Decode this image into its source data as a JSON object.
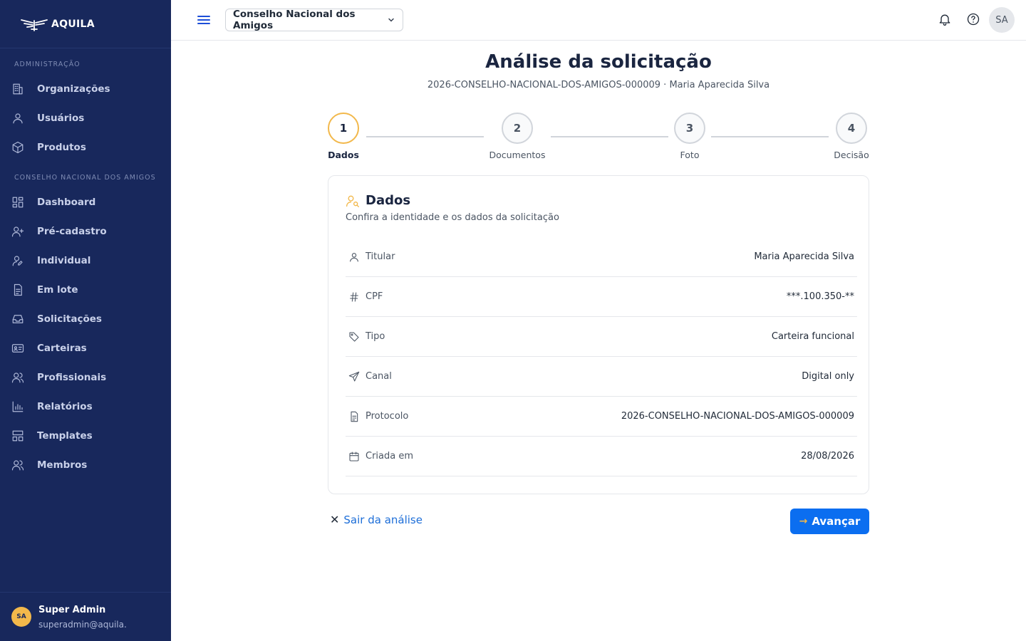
{
  "brand": {
    "name": "AQUILA"
  },
  "sidebar": {
    "section_admin": "ADMINISTRAÇÃO",
    "admin_items": [
      {
        "label": "Organizações",
        "icon": "building-icon"
      },
      {
        "label": "Usuários",
        "icon": "user-icon"
      },
      {
        "label": "Produtos",
        "icon": "box-icon"
      }
    ],
    "section_org": "CONSELHO NACIONAL DOS AMIGOS",
    "org_items": [
      {
        "label": "Dashboard",
        "icon": "grid-icon"
      },
      {
        "label": "Pré-cadastro",
        "icon": "user-plus-icon"
      },
      {
        "label": "Individual",
        "icon": "user-edit-icon"
      },
      {
        "label": "Em lote",
        "icon": "file-list-icon"
      },
      {
        "label": "Solicitações",
        "icon": "inbox-icon"
      },
      {
        "label": "Carteiras",
        "icon": "id-card-icon"
      },
      {
        "label": "Profissionais",
        "icon": "users-icon"
      },
      {
        "label": "Relatórios",
        "icon": "bar-chart-icon"
      },
      {
        "label": "Templates",
        "icon": "layout-icon"
      },
      {
        "label": "Membros",
        "icon": "users-icon"
      }
    ],
    "user": {
      "initials": "SA",
      "name": "Super Admin",
      "email": "superadmin@aquila."
    }
  },
  "topbar": {
    "org_select": "Conselho Nacional dos Amigos",
    "avatar_initials": "SA"
  },
  "page": {
    "title": "Análise da solicitação",
    "subtitle": "2026-CONSELHO-NACIONAL-DOS-AMIGOS-000009 · Maria Aparecida Silva"
  },
  "stepper": {
    "steps": [
      {
        "number": "1",
        "label": "Dados",
        "active": true
      },
      {
        "number": "2",
        "label": "Documentos",
        "active": false
      },
      {
        "number": "3",
        "label": "Foto",
        "active": false
      },
      {
        "number": "4",
        "label": "Decisão",
        "active": false
      }
    ]
  },
  "card": {
    "title": "Dados",
    "subtitle": "Confira a identidade e os dados da solicitação",
    "rows": [
      {
        "label": "Titular",
        "value": "Maria Aparecida Silva",
        "icon": "user-icon"
      },
      {
        "label": "CPF",
        "value": "***.100.350-**",
        "icon": "hash-icon"
      },
      {
        "label": "Tipo",
        "value": "Carteira funcional",
        "icon": "tag-icon"
      },
      {
        "label": "Canal",
        "value": "Digital only",
        "icon": "send-icon"
      },
      {
        "label": "Protocolo",
        "value": "2026-CONSELHO-NACIONAL-DOS-AMIGOS-000009",
        "icon": "document-icon"
      },
      {
        "label": "Criada em",
        "value": "28/08/2026",
        "icon": "calendar-icon"
      }
    ]
  },
  "actions": {
    "exit_label": "Sair da análise",
    "next_label": "Avançar"
  },
  "colors": {
    "sidebar_bg": "#18285c",
    "accent": "#f2b84b",
    "primary": "#0b6ef0"
  }
}
